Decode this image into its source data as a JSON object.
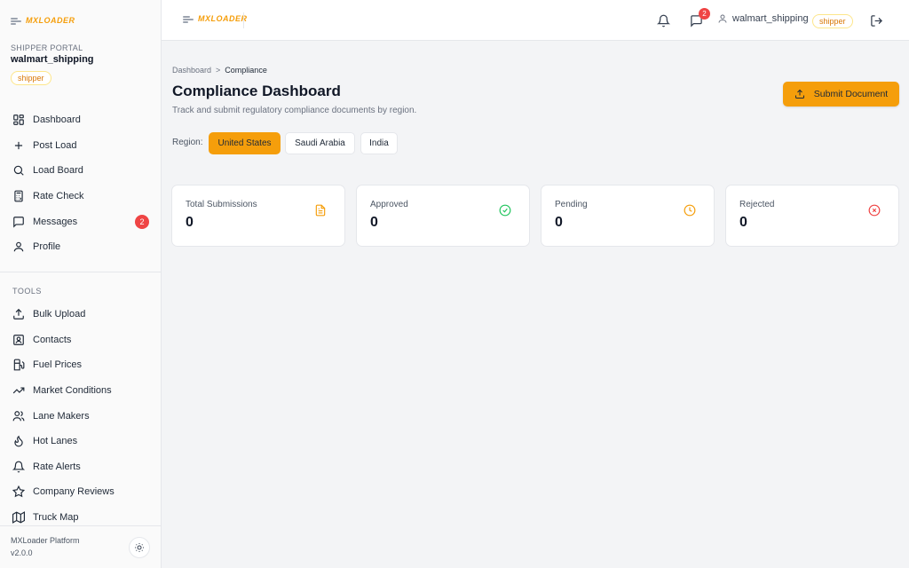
{
  "brand": {
    "name": "MXLOADER",
    "accent": "#f59e0b"
  },
  "sidebar": {
    "portal_label": "SHIPPER PORTAL",
    "username": "walmart_shipping",
    "role": "shipper",
    "nav": [
      {
        "label": "Dashboard",
        "icon": "grid-icon"
      },
      {
        "label": "Post Load",
        "icon": "plus-icon"
      },
      {
        "label": "Load Board",
        "icon": "search-icon"
      },
      {
        "label": "Rate Check",
        "icon": "calculator-icon"
      },
      {
        "label": "Messages",
        "icon": "chat-icon",
        "badge": "2"
      },
      {
        "label": "Profile",
        "icon": "user-icon"
      }
    ],
    "tools_label": "TOOLS",
    "tools": [
      {
        "label": "Bulk Upload",
        "icon": "upload-icon"
      },
      {
        "label": "Contacts",
        "icon": "contacts-icon"
      },
      {
        "label": "Fuel Prices",
        "icon": "fuel-icon"
      },
      {
        "label": "Market Conditions",
        "icon": "trend-icon"
      },
      {
        "label": "Lane Makers",
        "icon": "users-icon"
      },
      {
        "label": "Hot Lanes",
        "icon": "flame-icon"
      },
      {
        "label": "Rate Alerts",
        "icon": "bell-icon"
      },
      {
        "label": "Company Reviews",
        "icon": "star-icon"
      },
      {
        "label": "Truck Map",
        "icon": "map-icon"
      }
    ],
    "footer": {
      "platform": "MXLoader Platform",
      "version": "v2.0.0"
    }
  },
  "topbar": {
    "messages_badge": "2",
    "username": "walmart_shipping",
    "role": "shipper"
  },
  "main": {
    "breadcrumb": {
      "parent": "Dashboard",
      "separator": ">",
      "current": "Compliance"
    },
    "title": "Compliance Dashboard",
    "subtitle": "Track and submit regulatory compliance documents by region.",
    "submit_label": "Submit Document",
    "region_label": "Region:",
    "regions": [
      "United States",
      "Saudi Arabia",
      "India"
    ],
    "active_region": "United States",
    "stats": [
      {
        "label": "Total Submissions",
        "value": "0",
        "icon": "document-icon",
        "color": "#f59e0b"
      },
      {
        "label": "Approved",
        "value": "0",
        "icon": "check-circle-icon",
        "color": "#22c55e"
      },
      {
        "label": "Pending",
        "value": "0",
        "icon": "clock-icon",
        "color": "#f59e0b"
      },
      {
        "label": "Rejected",
        "value": "0",
        "icon": "x-circle-icon",
        "color": "#ef4444"
      }
    ]
  }
}
